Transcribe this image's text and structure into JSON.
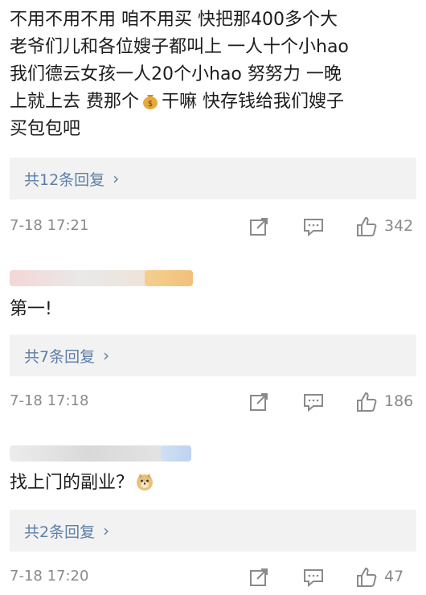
{
  "comments": [
    {
      "text_lines": [
        "不用不用不用 咱不用买 快把那400多个大",
        "老爷们儿和各位嫂子都叫上 一人十个小hao",
        "我们德云女孩一人20个小hao 努努力 一晚",
        "上就上去 费那个",
        "买包包吧"
      ],
      "line4_tail": "干嘛 快存钱给我们嫂子",
      "replies_label": "共12条回复",
      "time": "7-18 17:21",
      "likes": "342"
    },
    {
      "text": "第一!",
      "replies_label": "共7条回复",
      "time": "7-18 17:18",
      "likes": "186"
    },
    {
      "text": "找上门的副业？",
      "replies_label": "共2条回复",
      "time": "7-18 17:20",
      "likes": "47"
    }
  ],
  "icons": {
    "inline_emoji_1": "money-bag-icon",
    "inline_emoji_2": "doge-icon",
    "share": "share-icon",
    "comment": "comment-icon",
    "like": "thumbs-up-icon"
  },
  "colors": {
    "link": "#5b7fa8",
    "meta": "#8a8a8a",
    "reply_bg": "#f2f2f2"
  }
}
